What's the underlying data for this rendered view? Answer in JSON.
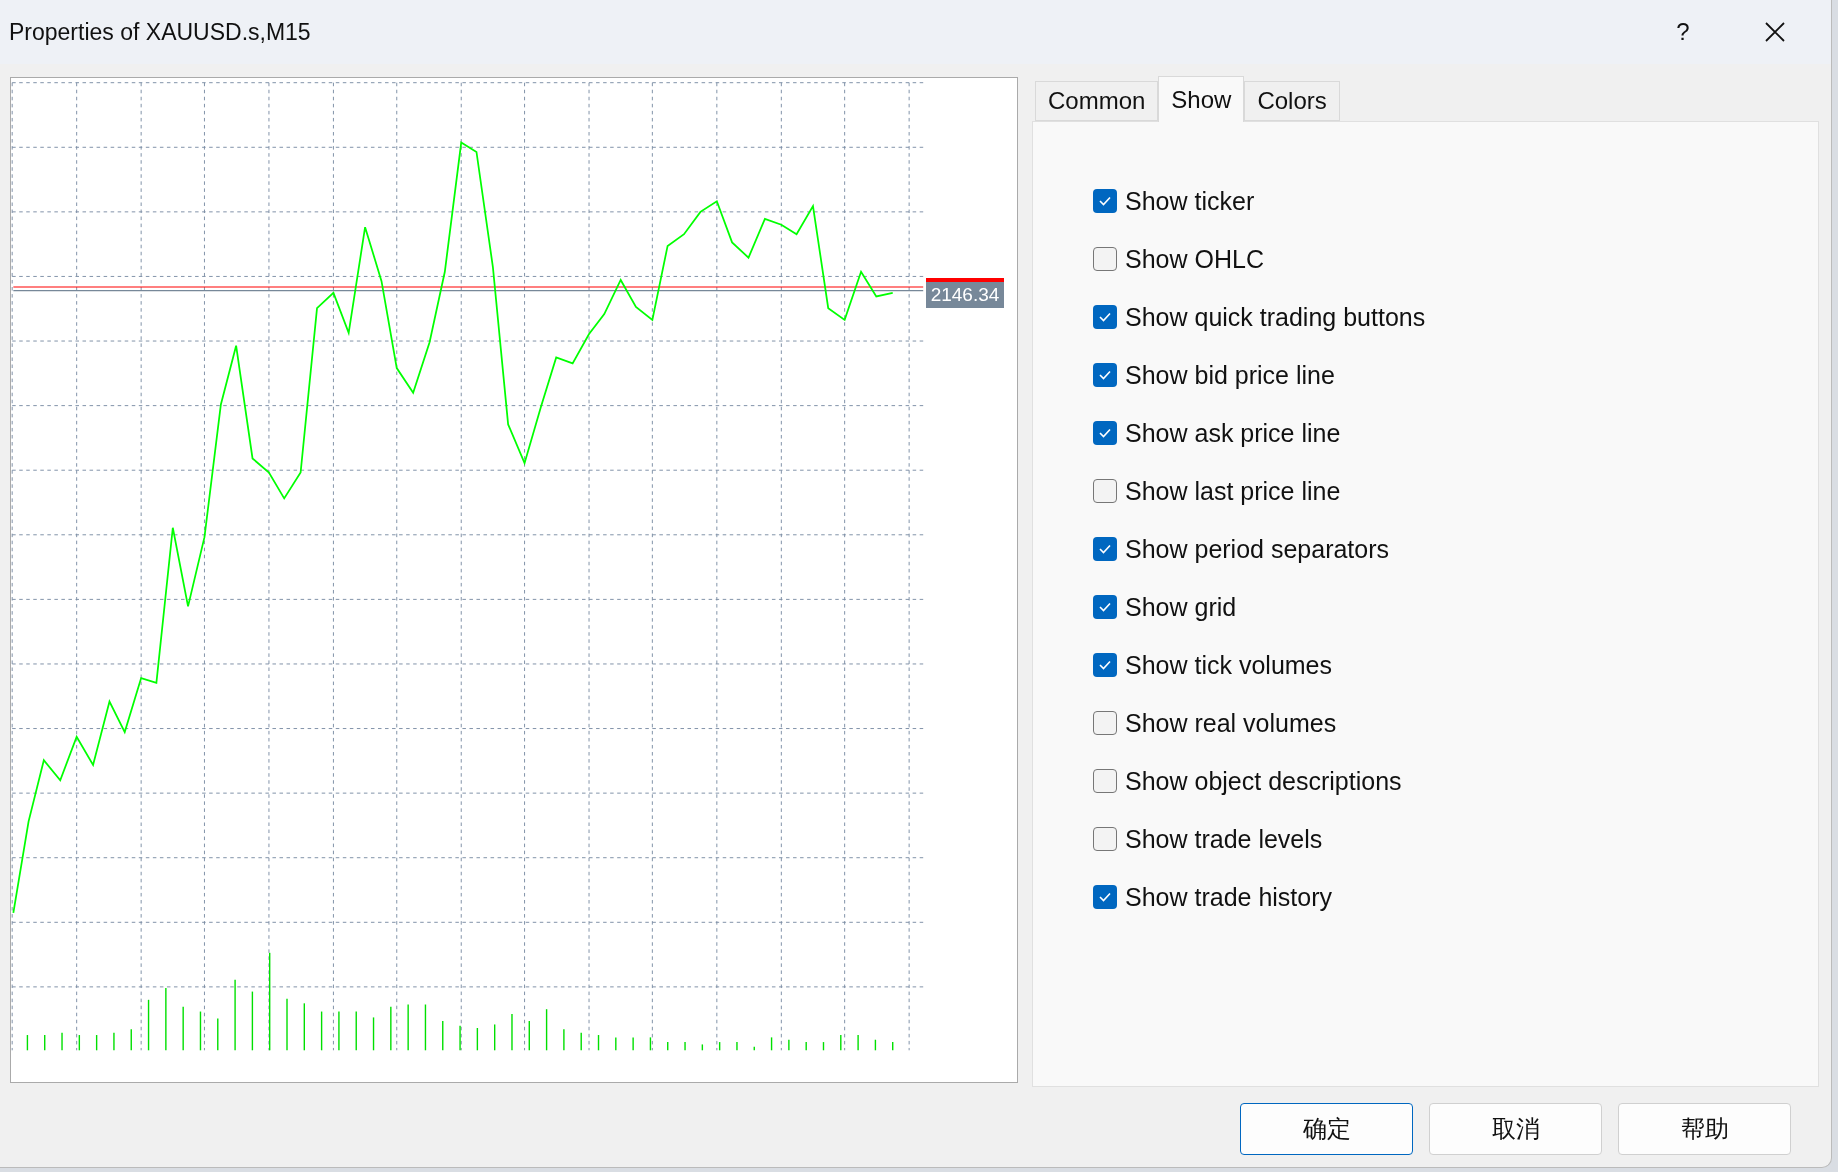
{
  "window": {
    "title": "Properties of XAUUSD.s,M15",
    "help": "?"
  },
  "chart": {
    "price_label": "2146.34"
  },
  "tabs": [
    {
      "label": "Common",
      "selected": false
    },
    {
      "label": "Show",
      "selected": true
    },
    {
      "label": "Colors",
      "selected": false
    }
  ],
  "options": [
    {
      "label": "Show ticker",
      "checked": true
    },
    {
      "label": "Show OHLC",
      "checked": false
    },
    {
      "label": "Show quick trading buttons",
      "checked": true
    },
    {
      "label": "Show bid price line",
      "checked": true
    },
    {
      "label": "Show ask price line",
      "checked": true
    },
    {
      "label": "Show last price line",
      "checked": false
    },
    {
      "label": "Show period separators",
      "checked": true
    },
    {
      "label": "Show grid",
      "checked": true
    },
    {
      "label": "Show tick volumes",
      "checked": true
    },
    {
      "label": "Show real volumes",
      "checked": false
    },
    {
      "label": "Show object descriptions",
      "checked": false
    },
    {
      "label": "Show trade levels",
      "checked": false
    },
    {
      "label": "Show trade history",
      "checked": true
    }
  ],
  "buttons": [
    {
      "label": "确定",
      "default": true
    },
    {
      "label": "取消",
      "default": false
    },
    {
      "label": "帮助",
      "default": false
    }
  ]
}
